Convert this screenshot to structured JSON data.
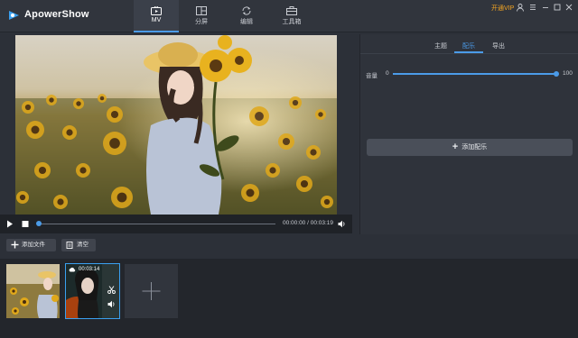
{
  "app": {
    "title": "ApowerShow"
  },
  "nav_tabs": [
    {
      "label": "MV",
      "icon": "mv-icon",
      "active": true
    },
    {
      "label": "分屏",
      "icon": "split-screen-icon"
    },
    {
      "label": "编辑",
      "icon": "edit-icon"
    },
    {
      "label": "工具箱",
      "icon": "toolbox-icon"
    }
  ],
  "header": {
    "vip_label": "开通VIP"
  },
  "player": {
    "time": "00:00:00 / 00:03:19",
    "progress": 0
  },
  "right_panel": {
    "tabs": [
      "主题",
      "配乐",
      "导出"
    ],
    "active_tab": "配乐",
    "volume_label": "音量",
    "volume_min": "0",
    "volume_max": "100",
    "volume_value": 100,
    "add_music_label": "添加配乐"
  },
  "toolbar": {
    "add_file_label": "添加文件",
    "clear_label": "清空"
  },
  "timeline": {
    "clip2_time": "00:03:14"
  },
  "colors": {
    "accent": "#4b9be8",
    "vip": "#f5a623"
  }
}
